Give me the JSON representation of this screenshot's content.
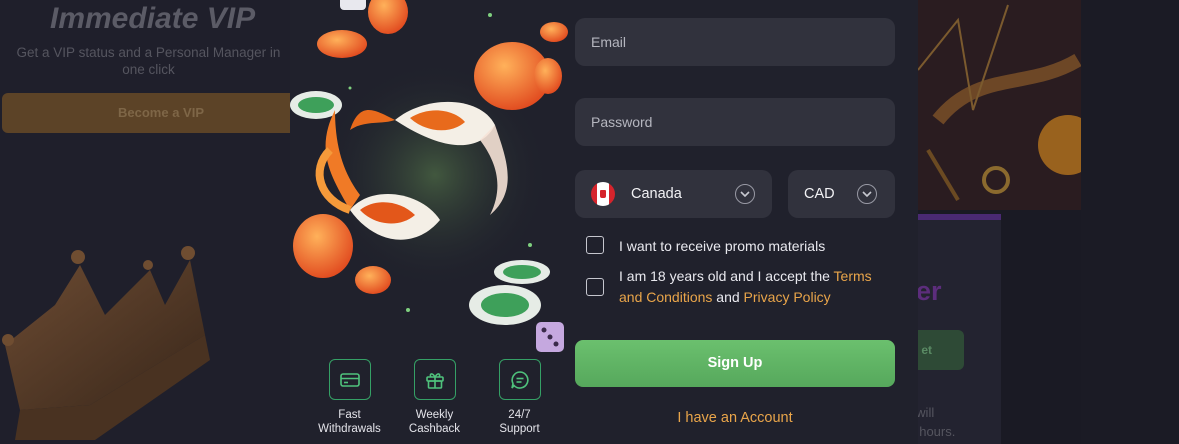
{
  "background": {
    "vip_title": "Immediate VIP",
    "vip_subtitle": "Get a VIP status and a Personal Manager in one click",
    "vip_button": "Become a VIP",
    "card_title_fragment": "er",
    "card_button_fragment": "et",
    "card_text_line1": "er will",
    "card_text_line2": ". hours."
  },
  "modal": {
    "features": [
      {
        "icon": "card-icon",
        "label_line1": "Fast",
        "label_line2": "Withdrawals"
      },
      {
        "icon": "gift-icon",
        "label_line1": "Weekly",
        "label_line2": "Cashback"
      },
      {
        "icon": "chat-icon",
        "label_line1": "24/7",
        "label_line2": "Support"
      }
    ],
    "form": {
      "email_placeholder": "Email",
      "password_placeholder": "Password",
      "country": "Canada",
      "currency": "CAD",
      "promo_label": "I want to receive promo materials",
      "age_prefix": "I am 18 years old and I accept the ",
      "terms_link": "Terms and Conditions",
      "and_text": " and ",
      "privacy_link": "Privacy Policy",
      "signup_button": "Sign Up",
      "account_link": "I have an Account"
    }
  },
  "colors": {
    "accent_green": "#5fb463",
    "link_orange": "#e9a54a",
    "field_bg": "#31323d",
    "modal_bg": "#20212c"
  }
}
